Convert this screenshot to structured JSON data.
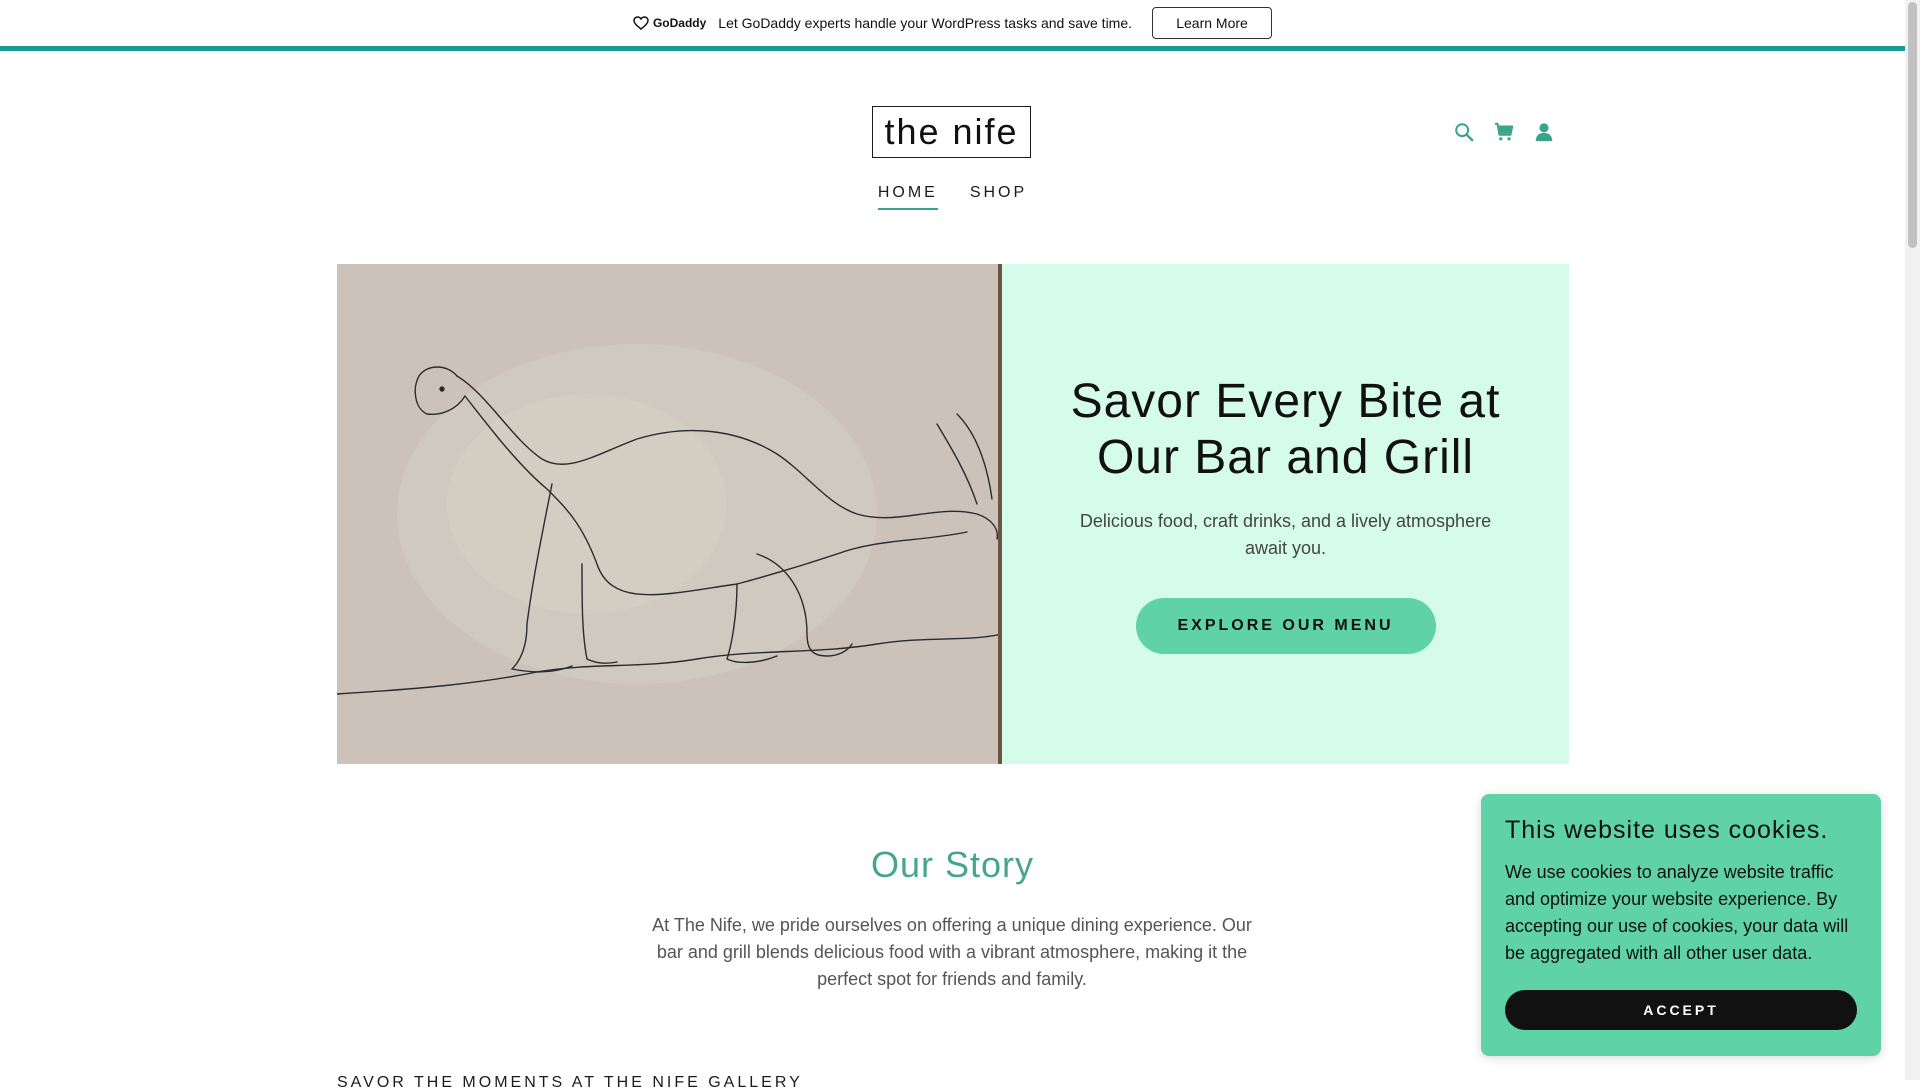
{
  "promo": {
    "brand": "GoDaddy",
    "message": "Let GoDaddy experts handle your WordPress tasks and save time.",
    "button_label": "Learn More",
    "border_color": "#1a9a94"
  },
  "header": {
    "logo": "the nife",
    "icons": [
      "search-icon",
      "cart-icon",
      "account-icon"
    ],
    "nav": [
      {
        "label": "HOME",
        "active": true
      },
      {
        "label": "SHOP",
        "active": false
      }
    ]
  },
  "hero": {
    "image_alt": "pencil drawing of a long-necked dinosaur",
    "title": "Savor Every Bite at Our Bar and Grill",
    "subtitle": "Delicious food, craft drinks, and a lively atmosphere await you.",
    "cta_label": "EXPLORE OUR MENU",
    "panel_color": "#d5fbea",
    "cta_color": "#5fd2a7"
  },
  "story": {
    "title": "Our Story",
    "text": "At The Nife, we pride ourselves on offering a unique dining experience. Our bar and grill blends delicious food with a vibrant atmosphere, making it the perfect spot for friends and family.",
    "title_color": "#46a58b"
  },
  "gallery": {
    "heading": "SAVOR THE MOMENTS AT THE NIFE GALLERY"
  },
  "cookie": {
    "title": "This website uses cookies.",
    "text": "We use cookies to analyze website traffic and optimize your website experience. By accepting our use of cookies, your data will be aggregated with all other user data.",
    "accept_label": "ACCEPT",
    "background": "#5fd2a7"
  }
}
